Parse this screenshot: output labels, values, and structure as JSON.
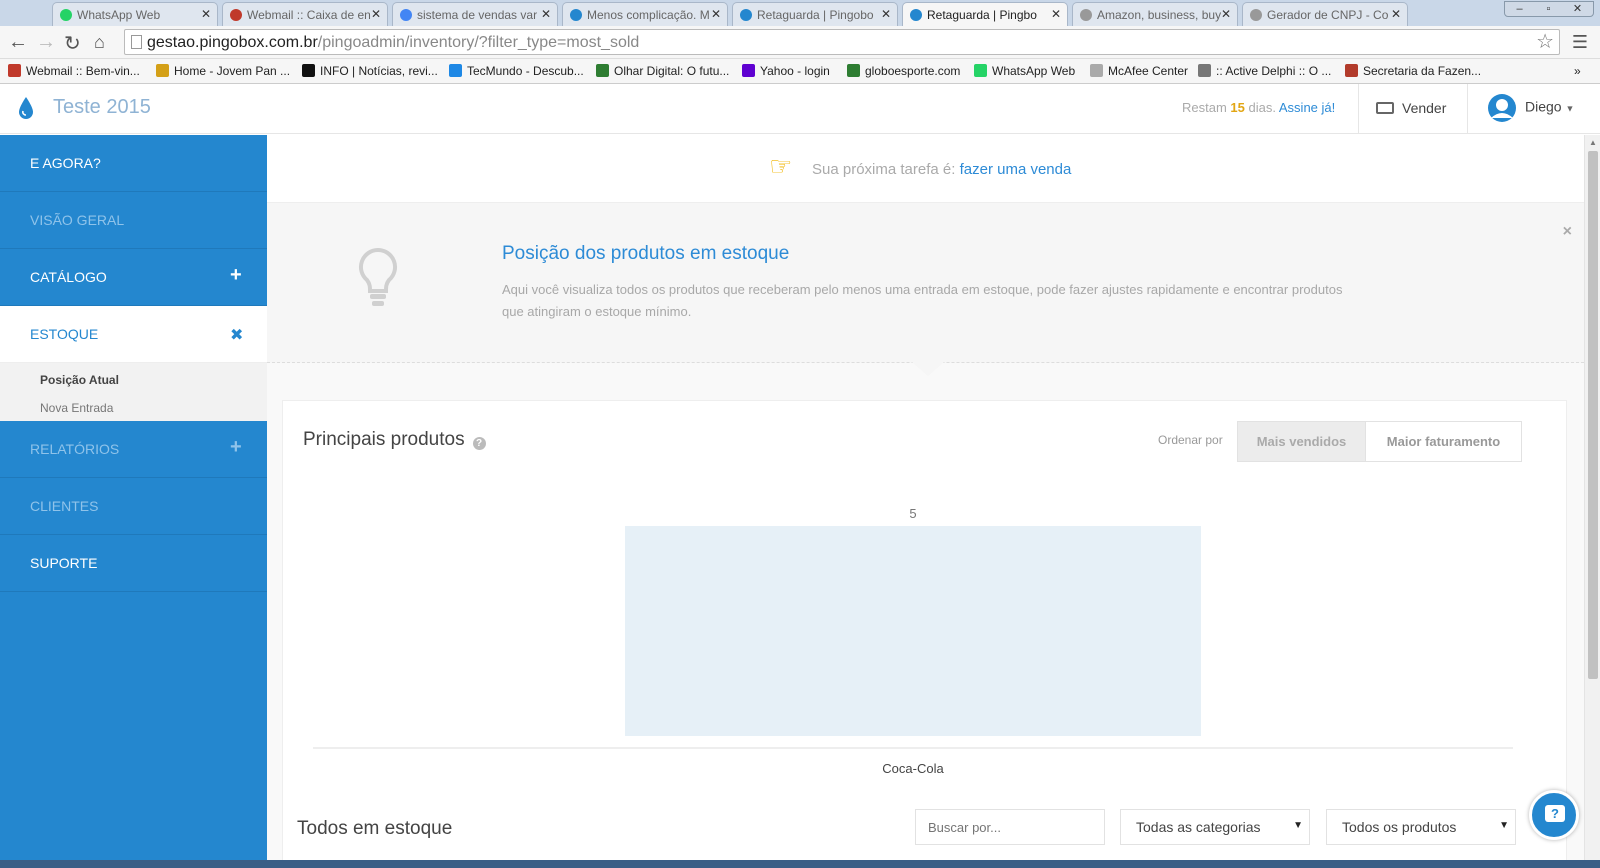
{
  "browser": {
    "tabs": [
      {
        "title": "WhatsApp Web",
        "icon": "whatsapp-icon",
        "color": "#25d366"
      },
      {
        "title": "Webmail :: Caixa de en",
        "icon": "mail-icon",
        "color": "#c0392b"
      },
      {
        "title": "sistema de vendas var",
        "icon": "google-icon",
        "color": "#4285f4"
      },
      {
        "title": "Menos complicação. M",
        "icon": "drop-icon",
        "color": "#2487cf"
      },
      {
        "title": "Retaguarda | Pingobo",
        "icon": "drop-icon",
        "color": "#2487cf"
      },
      {
        "title": "Retaguarda | Pingbo",
        "icon": "drop-icon",
        "color": "#2487cf"
      },
      {
        "title": "Amazon, business, buy",
        "icon": "page-icon",
        "color": "#999999"
      },
      {
        "title": "Gerador de CNPJ - Co",
        "icon": "page-icon",
        "color": "#999999"
      }
    ],
    "active_tab_index": 5,
    "window_controls": [
      "–",
      "▫",
      "✕"
    ],
    "url_host": "gestao.pingobox.com.br",
    "url_path": "/pingoadmin/inventory/?filter_type=most_sold",
    "bookmarks": [
      {
        "label": "Webmail :: Bem-vin...",
        "icon": "mail-icon",
        "color": "#c0392b"
      },
      {
        "label": "Home - Jovem Pan ...",
        "icon": "radio-icon",
        "color": "#d4a017"
      },
      {
        "label": "INFO | Notícias, revi...",
        "icon": "info-icon",
        "color": "#111111"
      },
      {
        "label": "TecMundo - Descub...",
        "icon": "tecmundo-icon",
        "color": "#1e88e5"
      },
      {
        "label": "Olhar Digital: O futu...",
        "icon": "eye-icon",
        "color": "#2e7d32"
      },
      {
        "label": "Yahoo - login",
        "icon": "yahoo-icon",
        "color": "#5f01d1"
      },
      {
        "label": "globoesporte.com",
        "icon": "ge-icon",
        "color": "#2e7d32"
      },
      {
        "label": "WhatsApp Web",
        "icon": "whatsapp-icon",
        "color": "#25d366"
      },
      {
        "label": "McAfee Center",
        "icon": "page-icon",
        "color": "#aaaaaa"
      },
      {
        "label": ":: Active Delphi :: O ...",
        "icon": "building-icon",
        "color": "#777777"
      },
      {
        "label": "Secretaria da Fazen...",
        "icon": "seal-icon",
        "color": "#b23b2b"
      }
    ],
    "more_bookmarks": "»"
  },
  "header": {
    "app_name": "Teste 2015",
    "trial_prefix": "Restam",
    "trial_days": "15",
    "trial_suffix": "dias.",
    "trial_cta": "Assine já!",
    "sell_label": "Vender",
    "user_name": "Diego",
    "brand_color": "#2487cf"
  },
  "sidebar": {
    "items": [
      {
        "label": "E AGORA?",
        "toggle": ""
      },
      {
        "label": "VISÃO GERAL",
        "toggle": ""
      },
      {
        "label": "CATÁLOGO",
        "toggle": "+"
      },
      {
        "label": "ESTOQUE",
        "toggle": "✖"
      },
      {
        "label": "RELATÓRIOS",
        "toggle": "+"
      },
      {
        "label": "CLIENTES",
        "toggle": ""
      },
      {
        "label": "SUPORTE",
        "toggle": ""
      }
    ],
    "submenu": [
      "Posição Atual",
      "Nova Entrada"
    ]
  },
  "task": {
    "prefix": "Sua próxima tarefa é:",
    "link": "fazer uma venda"
  },
  "info": {
    "title": "Posição dos produtos em estoque",
    "description": "Aqui você visualiza todos os produtos que receberam pelo menos uma entrada em estoque, pode fazer ajustes rapidamente e encontrar produtos que atingiram o estoque mínimo.",
    "close": "×"
  },
  "top_products": {
    "title": "Principais produtos",
    "help": "?",
    "order_label": "Ordenar por",
    "order_options": [
      "Mais vendidos",
      "Maior faturamento"
    ],
    "selected_order": "Mais vendidos"
  },
  "chart_data": {
    "type": "bar",
    "categories": [
      "Coca-Cola"
    ],
    "values": [
      5
    ],
    "bar_color": "#e6f0f7",
    "title": "",
    "xlabel": "",
    "ylabel": ""
  },
  "stock": {
    "title": "Todos em estoque",
    "search_placeholder": "Buscar por...",
    "category_select": "Todas as categorias",
    "product_select": "Todos os produtos"
  },
  "chat": {
    "icon": "chat-help-icon",
    "glyph": "?"
  }
}
